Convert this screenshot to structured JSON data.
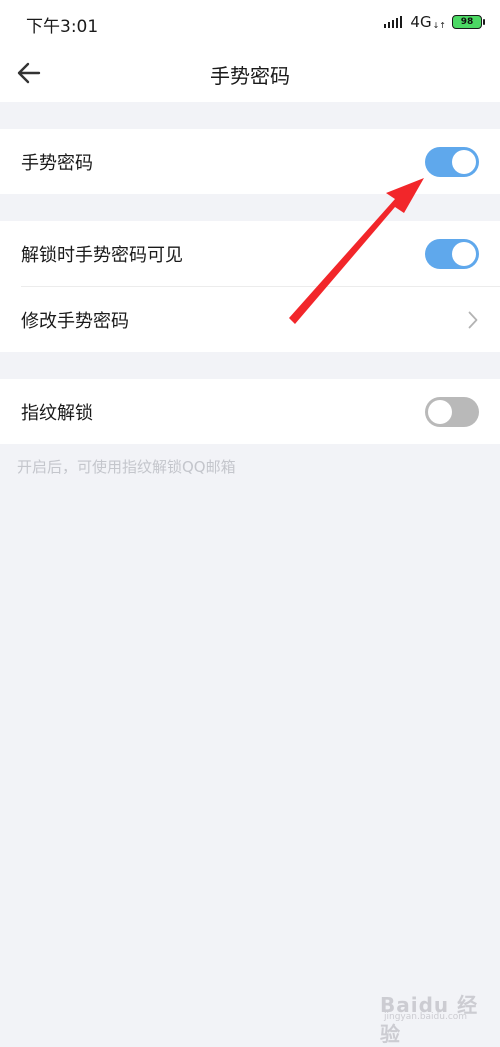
{
  "status_bar": {
    "time": "下午3:01",
    "network": "4G",
    "network_arrows": "↓↑",
    "battery": "98",
    "battery_color": "#4cd964"
  },
  "nav": {
    "title": "手势密码",
    "back_icon": "arrow-left-icon"
  },
  "settings": {
    "gesture_password": {
      "label": "手势密码",
      "enabled": true
    },
    "visible_when_unlocking": {
      "label": "解锁时手势密码可见",
      "enabled": true
    },
    "change_gesture_password": {
      "label": "修改手势密码",
      "icon": "chevron-right-icon"
    },
    "fingerprint_unlock": {
      "label": "指纹解锁",
      "enabled": false
    },
    "fingerprint_hint": "开启后，可使用指纹解锁QQ邮箱"
  },
  "colors": {
    "toggle_on": "#5fa8ec",
    "toggle_off": "#b9b9b9",
    "annotation_arrow": "#f2262a",
    "page_background": "#f2f3f7"
  },
  "watermark": {
    "text": "Baidu 经验",
    "sub": "jingyan.baidu.com"
  }
}
